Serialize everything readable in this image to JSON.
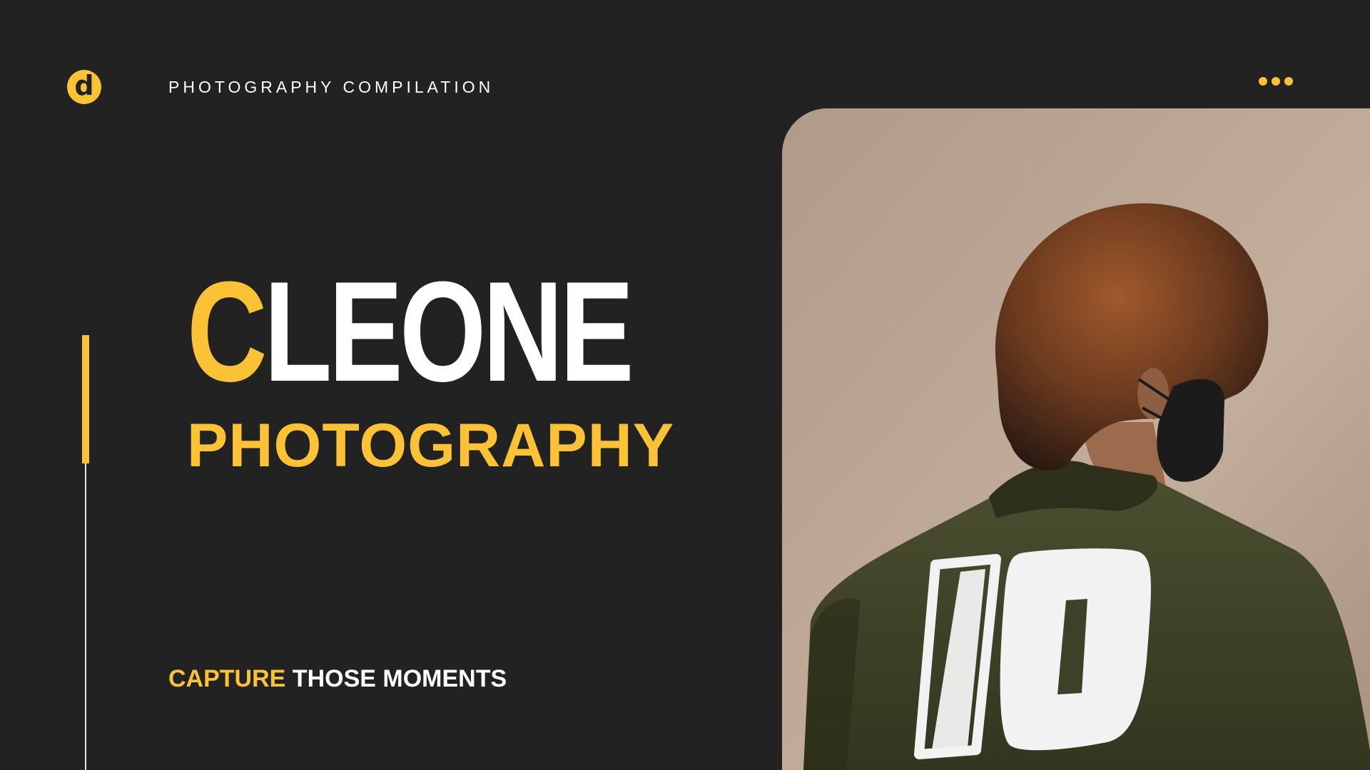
{
  "header": {
    "logo_letter": "d",
    "title": "PHOTOGRAPHY COMPILATION",
    "menu_icon": "more-horizontal-icon"
  },
  "hero": {
    "name_initial": "C",
    "name_rest": "LEONE",
    "subtitle": "PHOTOGRAPHY"
  },
  "tagline": {
    "accent": "CAPTURE",
    "rest": "THOSE MOMENTS"
  },
  "photo": {
    "jersey_number": "10"
  },
  "colors": {
    "background": "#222222",
    "accent": "#FCC235",
    "text": "#FFFFFF"
  }
}
